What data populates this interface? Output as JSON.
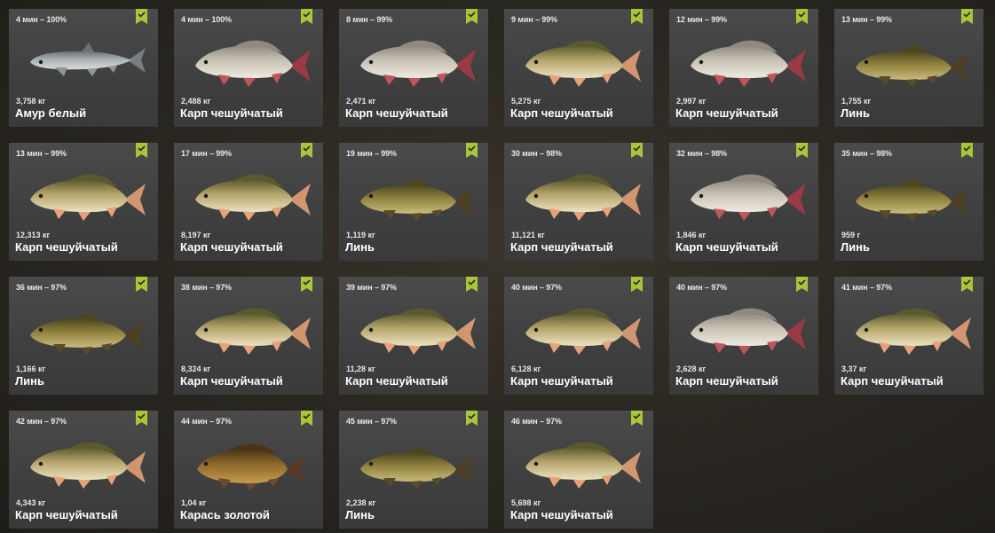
{
  "colors": {
    "card_bg": "#444444",
    "badge": "#a9c53a",
    "text": "#ffffff",
    "carp_body": "#b9a66b",
    "amur_body": "#9ea5a8",
    "tench_body": "#8f7f3a",
    "goldfish_body": "#8a6a2a"
  },
  "catches": [
    {
      "time": "4 мин – 100%",
      "weight": "3,758 кг",
      "name": "Амур белый",
      "kind": "amur",
      "icon": "check-badge-icon"
    },
    {
      "time": "4 мин – 100%",
      "weight": "2,488 кг",
      "name": "Карп чешуйчатый",
      "kind": "carp-silver",
      "icon": "check-badge-icon"
    },
    {
      "time": "8 мин – 99%",
      "weight": "2,471 кг",
      "name": "Карп чешуйчатый",
      "kind": "carp-silver",
      "icon": "check-badge-icon"
    },
    {
      "time": "9 мин – 99%",
      "weight": "5,275 кг",
      "name": "Карп чешуйчатый",
      "kind": "carp",
      "icon": "check-badge-icon"
    },
    {
      "time": "12 мин – 99%",
      "weight": "2,997 кг",
      "name": "Карп чешуйчатый",
      "kind": "carp-silver",
      "icon": "check-badge-icon"
    },
    {
      "time": "13 мин – 99%",
      "weight": "1,755 кг",
      "name": "Линь",
      "kind": "tench",
      "icon": "check-badge-icon"
    },
    {
      "time": "13 мин – 99%",
      "weight": "12,313 кг",
      "name": "Карп чешуйчатый",
      "kind": "carp",
      "icon": "check-badge-icon"
    },
    {
      "time": "17 мин – 99%",
      "weight": "8,197 кг",
      "name": "Карп чешуйчатый",
      "kind": "carp",
      "icon": "check-badge-icon"
    },
    {
      "time": "19 мин – 99%",
      "weight": "1,119 кг",
      "name": "Линь",
      "kind": "tench",
      "icon": "check-badge-icon"
    },
    {
      "time": "30 мин – 98%",
      "weight": "11,121 кг",
      "name": "Карп чешуйчатый",
      "kind": "carp",
      "icon": "check-badge-icon"
    },
    {
      "time": "32 мин – 98%",
      "weight": "1,846 кг",
      "name": "Карп чешуйчатый",
      "kind": "carp-silver",
      "icon": "check-badge-icon"
    },
    {
      "time": "35 мин – 98%",
      "weight": "959 г",
      "name": "Линь",
      "kind": "tench",
      "icon": "check-badge-icon"
    },
    {
      "time": "36 мин – 97%",
      "weight": "1,166 кг",
      "name": "Линь",
      "kind": "tench",
      "icon": "check-badge-icon"
    },
    {
      "time": "38 мин – 97%",
      "weight": "8,324 кг",
      "name": "Карп чешуйчатый",
      "kind": "carp",
      "icon": "check-badge-icon"
    },
    {
      "time": "39 мин – 97%",
      "weight": "11,28 кг",
      "name": "Карп чешуйчатый",
      "kind": "carp",
      "icon": "check-badge-icon"
    },
    {
      "time": "40 мин – 97%",
      "weight": "6,128 кг",
      "name": "Карп чешуйчатый",
      "kind": "carp",
      "icon": "check-badge-icon"
    },
    {
      "time": "40 мин – 97%",
      "weight": "2,628 кг",
      "name": "Карп чешуйчатый",
      "kind": "carp-silver",
      "icon": "check-badge-icon"
    },
    {
      "time": "41 мин – 97%",
      "weight": "3,37 кг",
      "name": "Карп чешуйчатый",
      "kind": "carp",
      "icon": "check-badge-icon"
    },
    {
      "time": "42 мин – 97%",
      "weight": "4,343 кг",
      "name": "Карп чешуйчатый",
      "kind": "carp",
      "icon": "check-badge-icon"
    },
    {
      "time": "44 мин – 97%",
      "weight": "1,04 кг",
      "name": "Карась золотой",
      "kind": "goldfish",
      "icon": "check-badge-icon"
    },
    {
      "time": "45 мин – 97%",
      "weight": "2,238 кг",
      "name": "Линь",
      "kind": "tench",
      "icon": "check-badge-icon"
    },
    {
      "time": "46 мин – 97%",
      "weight": "5,698 кг",
      "name": "Карп чешуйчатый",
      "kind": "carp",
      "icon": "check-badge-icon"
    }
  ]
}
